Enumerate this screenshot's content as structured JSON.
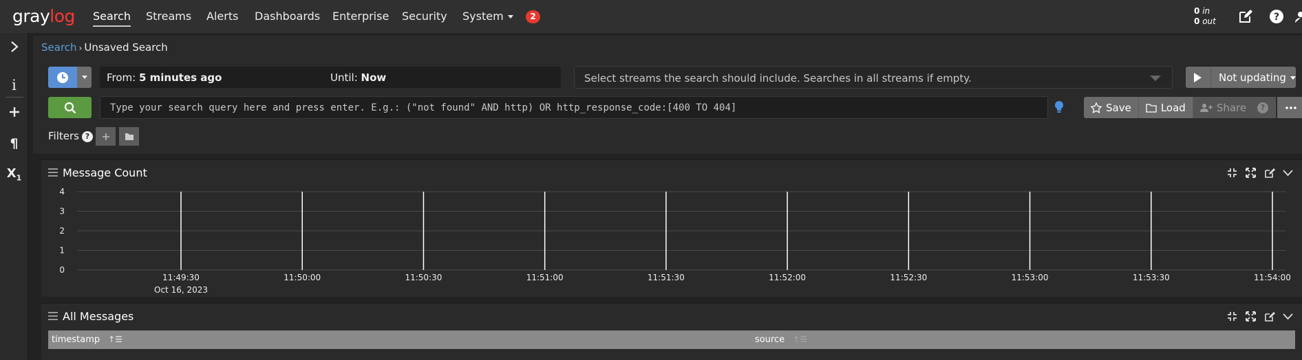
{
  "app": {
    "logo_text_a": "gray",
    "logo_text_b": "log"
  },
  "nav": {
    "items": [
      {
        "label": "Search"
      },
      {
        "label": "Streams"
      },
      {
        "label": "Alerts"
      },
      {
        "label": "Dashboards"
      },
      {
        "label": "Enterprise"
      },
      {
        "label": "Security"
      },
      {
        "label": "System"
      }
    ],
    "notification_count": "2",
    "throughput_in": "0",
    "throughput_in_label": "in",
    "throughput_out": "0",
    "throughput_out_label": "out"
  },
  "sidebar": {
    "icons": [
      "chevron-right-icon",
      "info-icon",
      "plus-icon",
      "pilcrow-icon",
      "subscript-icon"
    ]
  },
  "breadcrumb": {
    "parent": "Search",
    "current": "Unsaved Search"
  },
  "search": {
    "from_label": "From:",
    "from_value": "5 minutes ago",
    "until_label": "Until:",
    "until_value": "Now",
    "streams_placeholder": "Select streams the search should include. Searches in all streams if empty.",
    "refresh_label": "Not updating",
    "query_placeholder": "Type your search query here and press enter. E.g.: (\"not found\" AND http) OR http_response_code:[400 TO 404]",
    "save_label": "Save",
    "load_label": "Load",
    "share_label": "Share",
    "filters_label": "Filters"
  },
  "widgets": {
    "message_count": {
      "title": "Message Count"
    },
    "all_messages": {
      "title": "All Messages",
      "columns": [
        "timestamp",
        "source"
      ]
    }
  },
  "chart_data": {
    "type": "bar",
    "title": "Message Count",
    "x": [
      "11:49:30",
      "11:50:00",
      "11:50:30",
      "11:51:00",
      "11:51:30",
      "11:52:00",
      "11:52:30",
      "11:53:00",
      "11:53:30",
      "11:54:00"
    ],
    "x_date_label": "Oct 16, 2023",
    "y_ticks": [
      "0",
      "1",
      "2",
      "3",
      "4"
    ],
    "ylim": [
      0,
      4
    ],
    "values": [
      4,
      4,
      4,
      4,
      4,
      4,
      4,
      4,
      4,
      4
    ],
    "grid": true,
    "colors": {
      "bar": "#ffffff",
      "grid": "#4a4a4a"
    }
  }
}
